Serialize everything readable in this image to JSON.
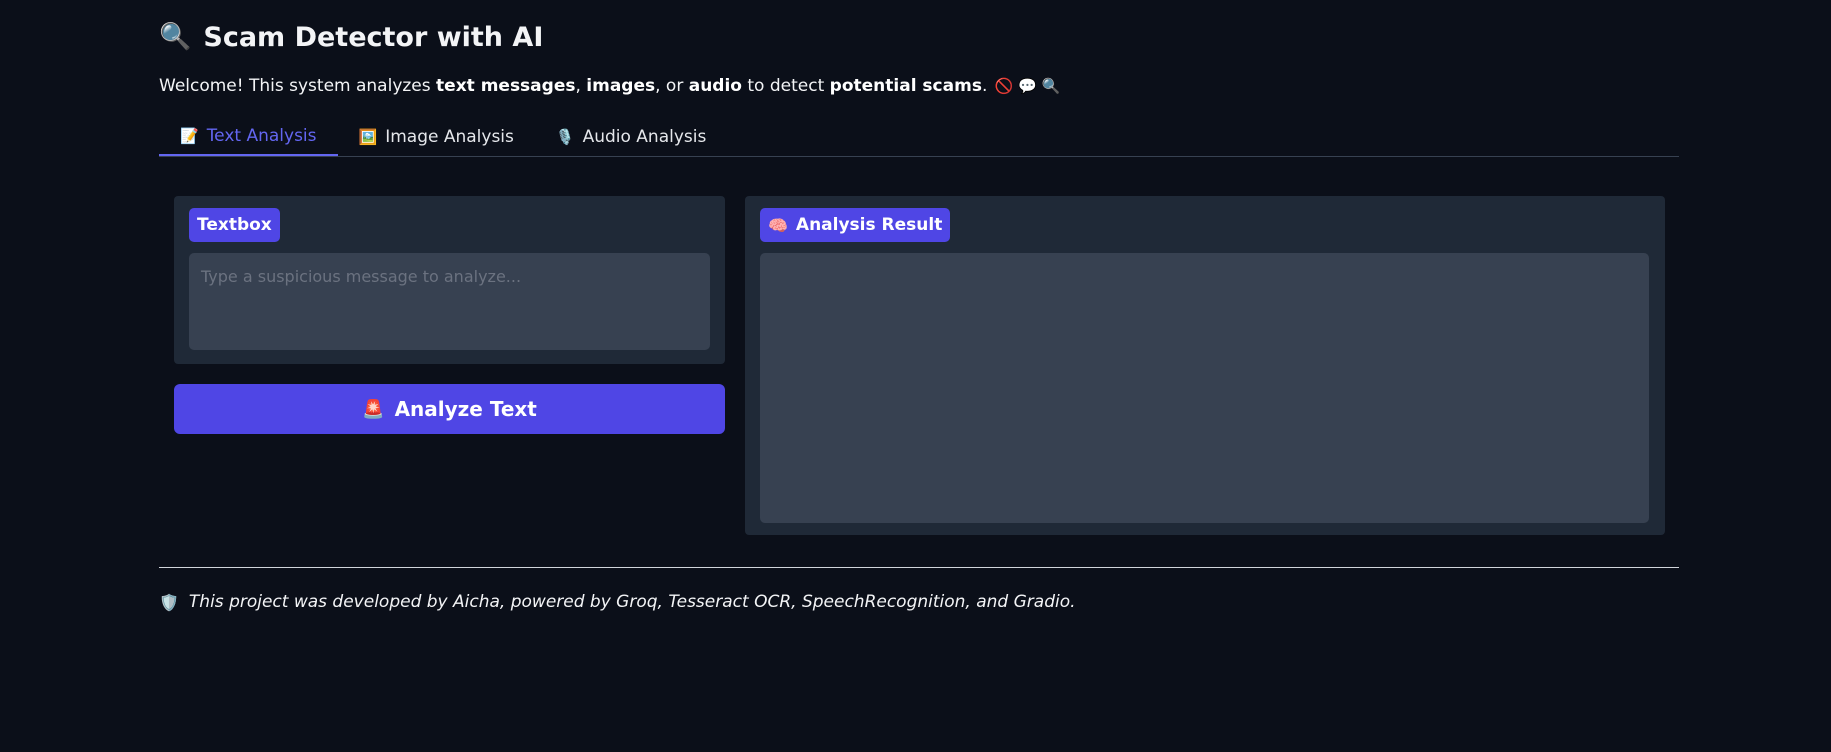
{
  "header": {
    "title_emoji": "🔍",
    "title": "Scam Detector with AI"
  },
  "welcome": {
    "part1": "Welcome! This system analyzes ",
    "bold1": "text messages",
    "part2": ", ",
    "bold2": "images",
    "part3": ", or ",
    "bold3": "audio",
    "part4": " to detect ",
    "bold4": "potential scams",
    "part5": ".",
    "emojis": "🚫 💬 🔍"
  },
  "tabs": [
    {
      "emoji": "📝",
      "label": "Text Analysis",
      "active": true
    },
    {
      "emoji": "🖼️",
      "label": "Image Analysis",
      "active": false
    },
    {
      "emoji": "🎙️",
      "label": "Audio Analysis",
      "active": false
    }
  ],
  "text_panel": {
    "label": "Textbox",
    "placeholder": "Type a suspicious message to analyze...",
    "value": ""
  },
  "analyze_button": {
    "emoji": "🚨",
    "label": "Analyze Text"
  },
  "result_panel": {
    "emoji": "🧠",
    "label": "Analysis Result",
    "value": ""
  },
  "footer": {
    "emoji": "🛡️",
    "text": "This project was developed by Aicha, powered by Groq, Tesseract OCR, SpeechRecognition, and Gradio."
  },
  "colors": {
    "background": "#0b0f19",
    "panel": "#1f2937",
    "input": "#374151",
    "accent": "#4f46e5",
    "tab_active": "#6366f1"
  }
}
